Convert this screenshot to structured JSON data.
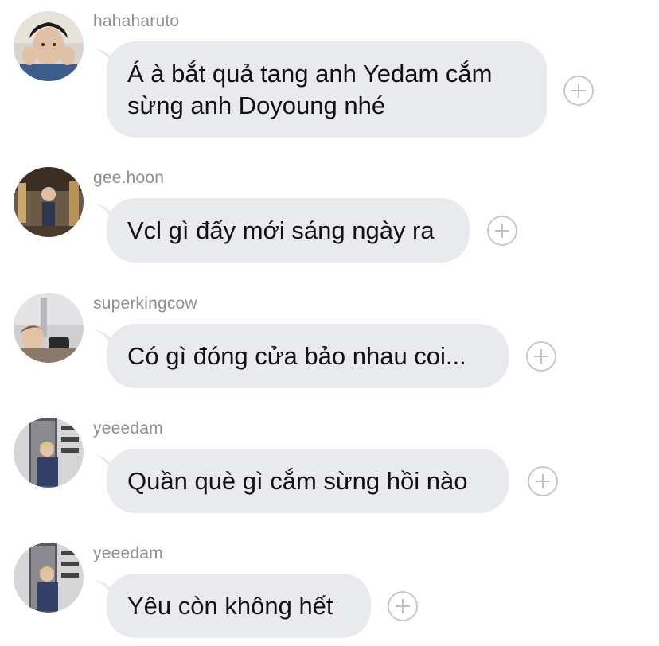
{
  "messages": [
    {
      "username": "hahaharuto",
      "text": "Á à bắt quả tang anh Yedam cắm sừng anh Doyoung nhé",
      "avatar_icon": "avatar-photo-hahaharuto"
    },
    {
      "username": "gee.hoon",
      "text": "Vcl gì đấy mới sáng ngày ra",
      "avatar_icon": "avatar-photo-gee-hoon"
    },
    {
      "username": "superkingcow",
      "text": "Có gì đóng cửa bảo nhau coi...",
      "avatar_icon": "avatar-photo-superkingcow"
    },
    {
      "username": "yeeedam",
      "text": "Quần què gì cắm sừng hồi nào",
      "avatar_icon": "avatar-photo-yeeedam"
    },
    {
      "username": "yeeedam",
      "text": "Yêu còn không hết",
      "avatar_icon": "avatar-photo-yeeedam"
    }
  ],
  "colors": {
    "bubble": "#e9eaee",
    "username": "#8e8e93",
    "text": "#111111",
    "plus_icon": "#c8c8cc"
  }
}
